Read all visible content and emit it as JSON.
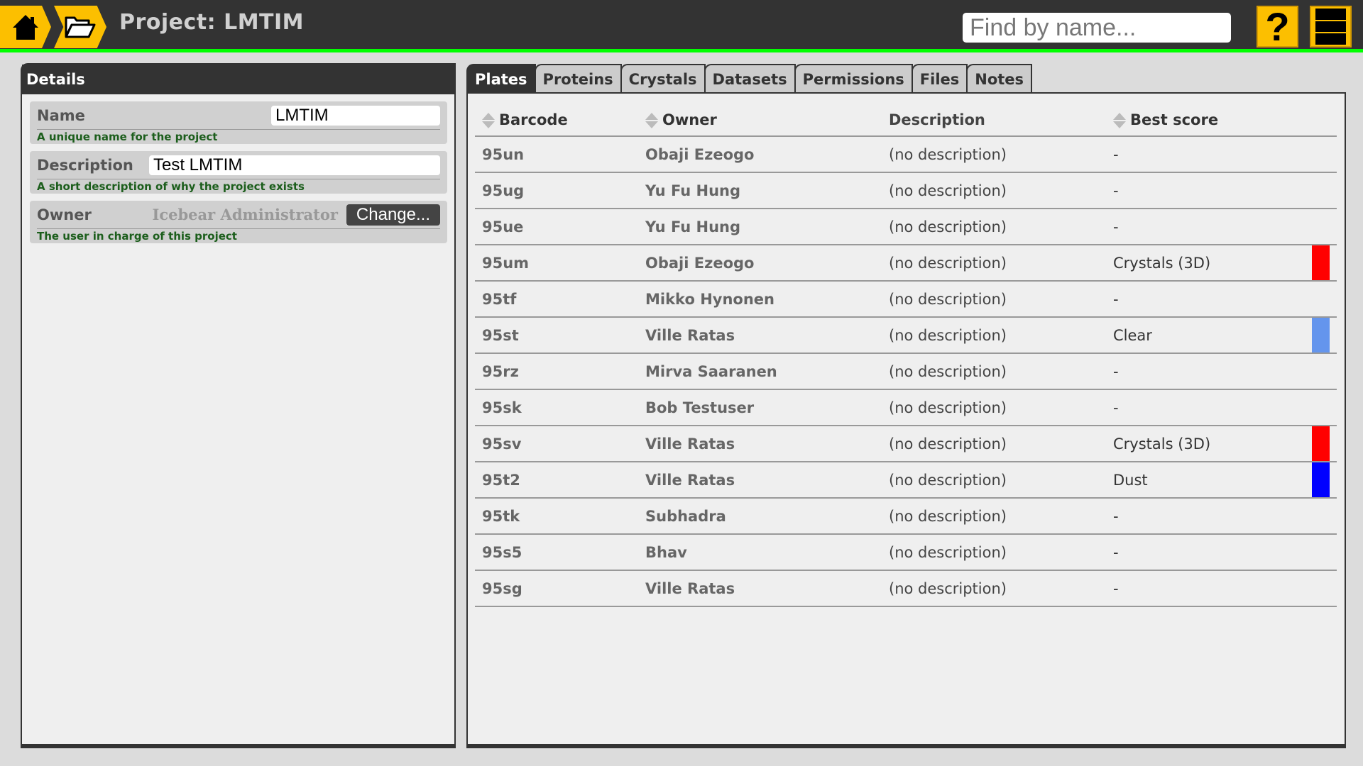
{
  "header": {
    "title": "Project: LMTIM",
    "search_placeholder": "Find by name...",
    "home_icon": "home-icon",
    "project_icon": "folder-open-icon",
    "help_label": "?",
    "menu_icon": "menu-icon"
  },
  "details": {
    "title": "Details",
    "name": {
      "label": "Name",
      "value": "LMTIM",
      "hint": "A unique name for the project"
    },
    "description": {
      "label": "Description",
      "value": "Test LMTIM",
      "hint": "A short description of why the project exists"
    },
    "owner": {
      "label": "Owner",
      "value": "Icebear Administrator",
      "button": "Change...",
      "hint": "The user in charge of this project"
    }
  },
  "tabs": [
    {
      "label": "Plates",
      "active": true
    },
    {
      "label": "Proteins"
    },
    {
      "label": "Crystals"
    },
    {
      "label": "Datasets"
    },
    {
      "label": "Permissions"
    },
    {
      "label": "Files"
    },
    {
      "label": "Notes"
    }
  ],
  "plates": {
    "columns": [
      "Barcode",
      "Owner",
      "Description",
      "Best score"
    ],
    "rows": [
      {
        "barcode": "95un",
        "owner": "Obaji Ezeogo",
        "description": "(no description)",
        "score": "-",
        "color": ""
      },
      {
        "barcode": "95ug",
        "owner": "Yu Fu Hung",
        "description": "(no description)",
        "score": "-",
        "color": ""
      },
      {
        "barcode": "95ue",
        "owner": "Yu Fu Hung",
        "description": "(no description)",
        "score": "-",
        "color": ""
      },
      {
        "barcode": "95um",
        "owner": "Obaji Ezeogo",
        "description": "(no description)",
        "score": "Crystals (3D)",
        "color": "#ff0000"
      },
      {
        "barcode": "95tf",
        "owner": "Mikko Hynonen",
        "description": "(no description)",
        "score": "-",
        "color": ""
      },
      {
        "barcode": "95st",
        "owner": "Ville Ratas",
        "description": "(no description)",
        "score": "Clear",
        "color": "#6495ed"
      },
      {
        "barcode": "95rz",
        "owner": "Mirva Saaranen",
        "description": "(no description)",
        "score": "-",
        "color": ""
      },
      {
        "barcode": "95sk",
        "owner": "Bob Testuser",
        "description": "(no description)",
        "score": "-",
        "color": ""
      },
      {
        "barcode": "95sv",
        "owner": "Ville Ratas",
        "description": "(no description)",
        "score": "Crystals (3D)",
        "color": "#ff0000"
      },
      {
        "barcode": "95t2",
        "owner": "Ville Ratas",
        "description": "(no description)",
        "score": "Dust",
        "color": "#0000ff"
      },
      {
        "barcode": "95tk",
        "owner": "Subhadra",
        "description": "(no description)",
        "score": "-",
        "color": ""
      },
      {
        "barcode": "95s5",
        "owner": "Bhav",
        "description": "(no description)",
        "score": "-",
        "color": ""
      },
      {
        "barcode": "95sg",
        "owner": "Ville Ratas",
        "description": "(no description)",
        "score": "-",
        "color": ""
      }
    ]
  },
  "colors": {
    "accent": "#fcbf00",
    "topbar": "#333333",
    "status_line": "#00ff00"
  }
}
